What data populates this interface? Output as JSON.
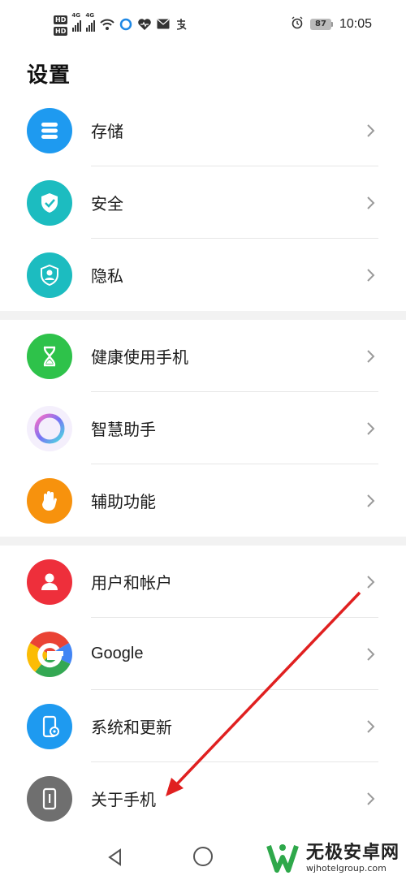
{
  "status_bar": {
    "hd1": "HD",
    "hd2": "HD",
    "net1": "4G",
    "net2": "4G",
    "battery": "87",
    "time": "10:05",
    "icons": [
      "wifi-icon",
      "browser-icon",
      "health-icon",
      "mail-icon",
      "alipay-icon",
      "alarm-icon"
    ]
  },
  "page": {
    "title": "设置"
  },
  "groups": [
    {
      "items": [
        {
          "label": "存储",
          "icon": "storage-icon",
          "color": "#1e9af0"
        },
        {
          "label": "安全",
          "icon": "shield-check-icon",
          "color": "#1cbcc0"
        },
        {
          "label": "隐私",
          "icon": "privacy-icon",
          "color": "#1cbcc0"
        }
      ]
    },
    {
      "items": [
        {
          "label": "健康使用手机",
          "icon": "hourglass-icon",
          "color": "#2ec24a"
        },
        {
          "label": "智慧助手",
          "icon": "assistant-ring-icon",
          "color": "#8a6cf0"
        },
        {
          "label": "辅助功能",
          "icon": "hand-icon",
          "color": "#f7920d"
        }
      ]
    },
    {
      "items": [
        {
          "label": "用户和帐户",
          "icon": "user-icon",
          "color": "#ee2f3b"
        },
        {
          "label": "Google",
          "icon": "google-icon",
          "color": "#4285f4"
        },
        {
          "label": "系统和更新",
          "icon": "system-update-icon",
          "color": "#1e9af0"
        },
        {
          "label": "关于手机",
          "icon": "phone-info-icon",
          "color": "#6f6f6f"
        }
      ]
    }
  ],
  "annotation": {
    "color": "#e02020"
  },
  "watermark": {
    "title": "无极安卓网",
    "url": "wjhotelgroup.com"
  }
}
